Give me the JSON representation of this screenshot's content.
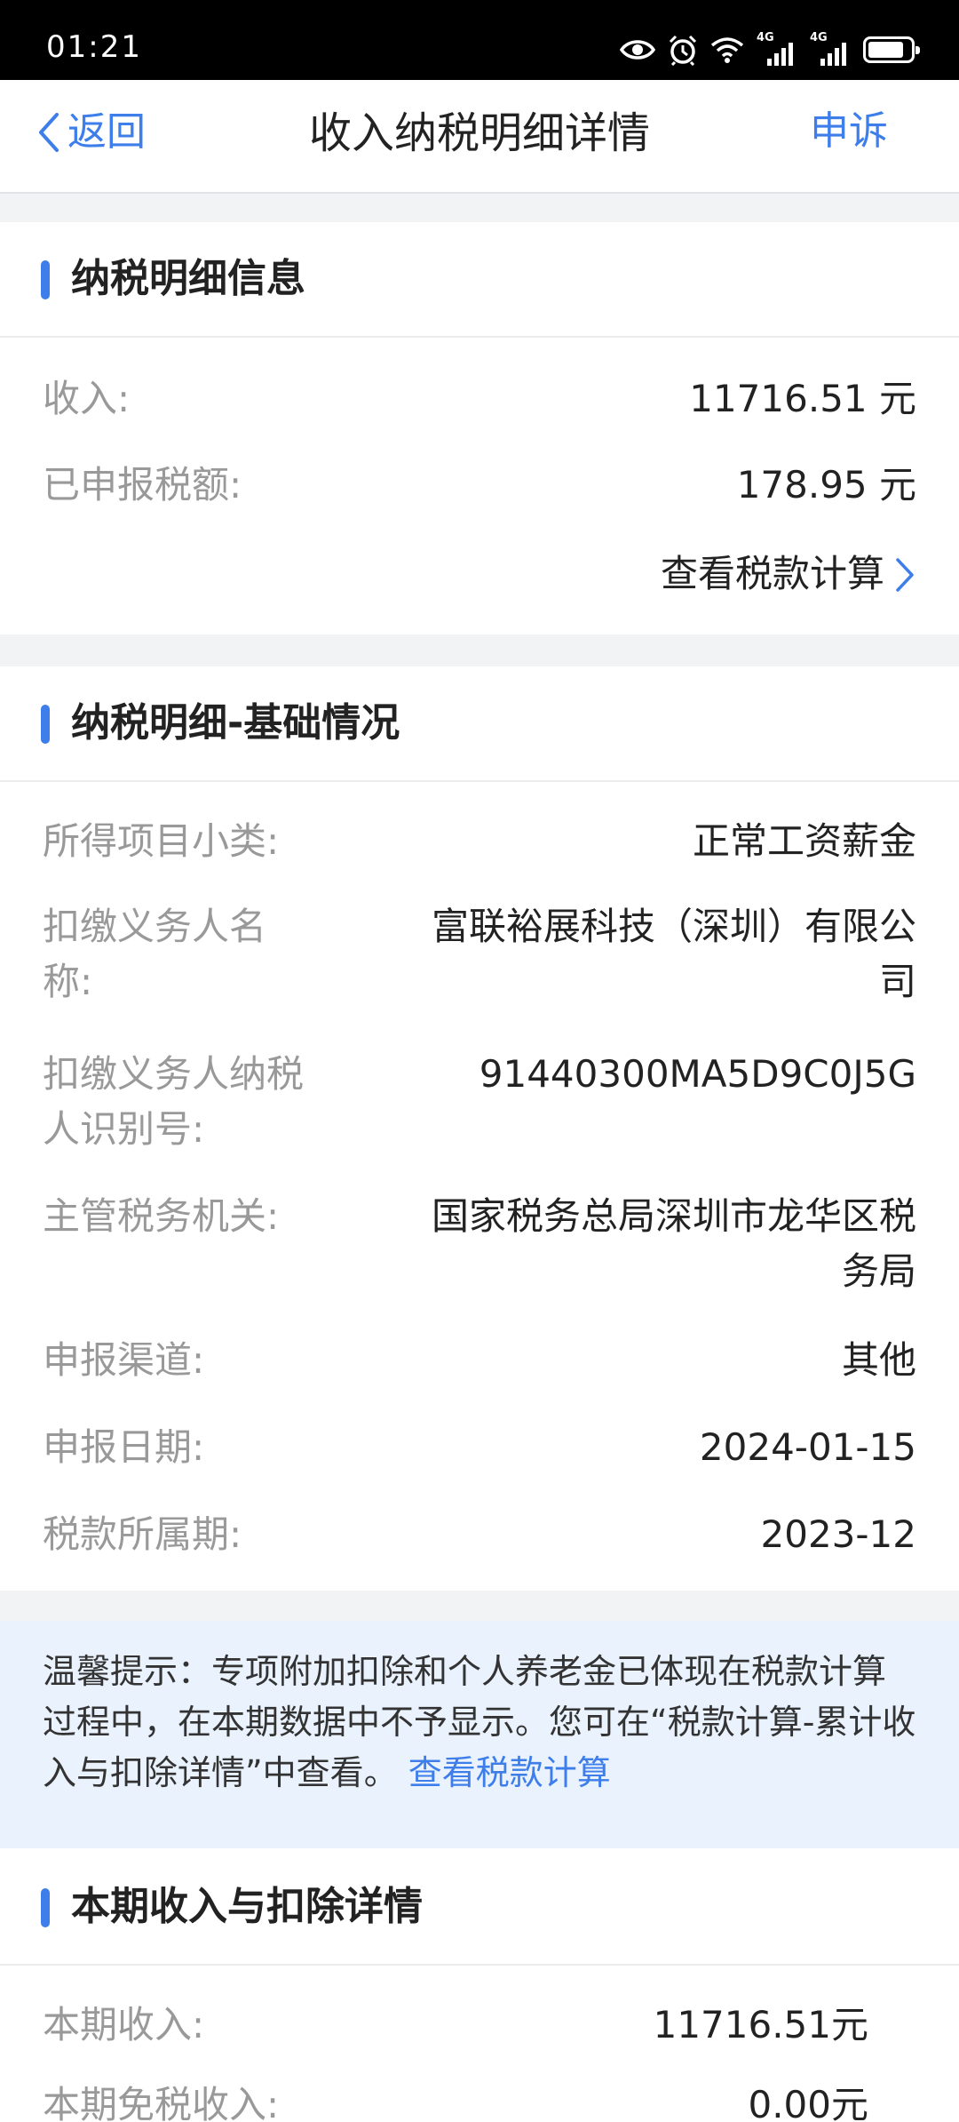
{
  "status_bar": {
    "time": "01:21",
    "net1": "4G",
    "net2": "4G",
    "battery_level": 0.85
  },
  "nav": {
    "back_label": "返回",
    "title": "收入纳税明细详情",
    "appeal_label": "申诉"
  },
  "tax_info": {
    "title": "纳税明细信息",
    "rows": [
      {
        "label": "收入:",
        "value": "11716.51 元"
      },
      {
        "label": "已申报税额:",
        "value": "178.95 元"
      }
    ],
    "link": "查看税款计算"
  },
  "basic": {
    "title": "纳税明细-基础情况",
    "category": {
      "label": "所得项目小类:",
      "value": "正常工资薪金"
    },
    "withholder_name": {
      "label1": "扣缴义务人名",
      "label2": "称:",
      "value1": "富联裕展科技（深圳）有限公",
      "value2": "司"
    },
    "withholder_id": {
      "label1": "扣缴义务人纳税",
      "label2": "人识别号:",
      "value": "91440300MA5D9C0J5G"
    },
    "authority": {
      "label": "主管税务机关:",
      "value1": "国家税务总局深圳市龙华区税",
      "value2": "务局"
    },
    "channel": {
      "label": "申报渠道:",
      "value": "其他"
    },
    "date": {
      "label": "申报日期:",
      "value": "2024-01-15"
    },
    "period": {
      "label": "税款所属期:",
      "value": "2023-12"
    }
  },
  "notice": {
    "text": "温馨提示：专项附加扣除和个人养老金已体现在税款计算过程中，在本期数据中不予显示。您可在“税款计算-累计收入与扣除详情”中查看。",
    "link": "查看税款计算"
  },
  "current": {
    "title": "本期收入与扣除详情",
    "rows": [
      {
        "label": "本期收入:",
        "value": "11716.51元"
      },
      {
        "label": "本期免税收入:",
        "value": "0.00元"
      }
    ]
  }
}
